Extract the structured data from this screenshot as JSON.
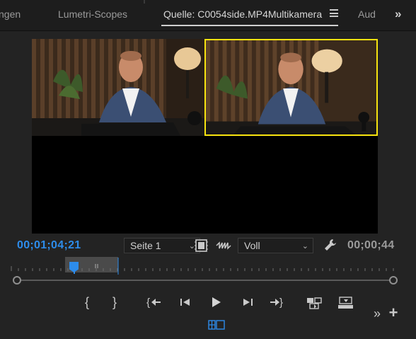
{
  "tabs": [
    {
      "label": "ngen"
    },
    {
      "label": "Lumetri-Scopes"
    },
    {
      "label": "Quelle: C0054side.MP4Multikamera"
    },
    {
      "label": "Aud"
    }
  ],
  "monitor": {
    "timecode_current": "00;01;04;21",
    "timecode_duration": "00;00;44",
    "page_select": "Seite 1",
    "zoom_select": "Voll"
  },
  "colors": {
    "accent": "#2d8ceb",
    "active_camera_border": "#f7e30f",
    "panel_bg": "#232323",
    "tab_bg": "#1d1d1d"
  },
  "icons": {
    "tab_menu": "hamburger-icon",
    "more": "double-chevron-right-icon",
    "export_frame": "film-strip-icon",
    "audio": "waveform-icon",
    "settings": "wrench-icon",
    "mark_in": "mark-in-icon",
    "mark_out": "mark-out-icon",
    "go_to_in": "go-to-in-icon",
    "step_back": "step-back-icon",
    "play": "play-icon",
    "step_forward": "step-forward-icon",
    "go_to_out": "go-to-out-icon",
    "insert": "insert-icon",
    "overwrite": "overwrite-icon",
    "add": "plus-icon",
    "multicam": "multicam-toggle-icon"
  }
}
